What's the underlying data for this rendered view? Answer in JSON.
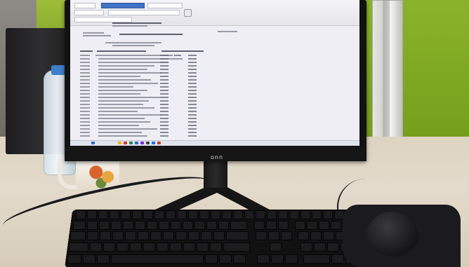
{
  "scene": {
    "monitor_brand": "onn",
    "screen_app": {
      "toolbar_label": "",
      "content_type": "spreadsheet-report"
    }
  }
}
